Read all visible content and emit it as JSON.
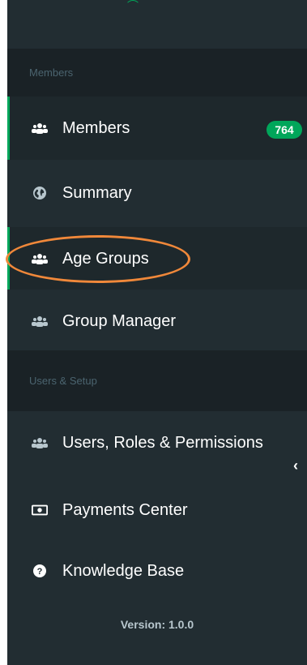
{
  "sidebar": {
    "sections": [
      {
        "header": "Members"
      },
      {
        "header": "Users & Setup"
      }
    ],
    "members_items": [
      {
        "label": "Members",
        "icon": "users-icon",
        "badge": "764"
      },
      {
        "label": "Summary",
        "icon": "globe-icon"
      },
      {
        "label": "Age Groups",
        "icon": "users-icon"
      },
      {
        "label": "Group Manager",
        "icon": "users-icon"
      }
    ],
    "setup_items": [
      {
        "label": "Users, Roles & Permissions",
        "icon": "users-icon"
      },
      {
        "label": "Payments Center",
        "icon": "money-icon"
      },
      {
        "label": "Knowledge Base",
        "icon": "question-circle-icon"
      }
    ],
    "version": "Version: 1.0.0"
  },
  "colors": {
    "sidebar_bg": "#222d32",
    "section_bg": "#1a2226",
    "accent_green": "#00a65a",
    "highlight_orange": "#f0883a"
  }
}
